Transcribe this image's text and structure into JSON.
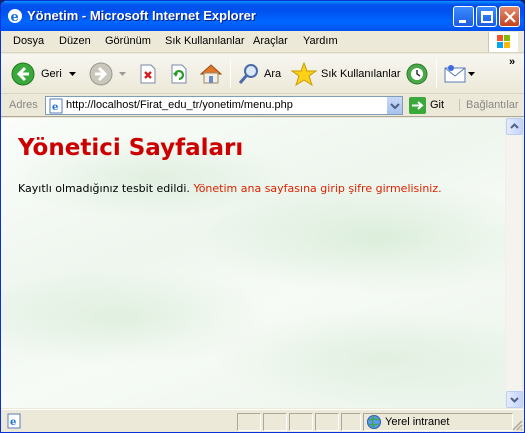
{
  "window": {
    "title": "Yönetim - Microsoft Internet Explorer"
  },
  "menubar": {
    "items": [
      {
        "label": "Dosya"
      },
      {
        "label": "Düzen"
      },
      {
        "label": "Görünüm"
      },
      {
        "label": "Sık Kullanılanlar"
      },
      {
        "label": "Araçlar"
      },
      {
        "label": "Yardım"
      }
    ]
  },
  "toolbar": {
    "back_label": "Geri",
    "search_label": "Ara",
    "favorites_label": "Sık Kullanılanlar",
    "overflow": "»"
  },
  "addressbar": {
    "label": "Adres",
    "url": "http://localhost/Firat_edu_tr/yonetim/menu.php",
    "go_label": "Git",
    "links_label": "Bağlantılar"
  },
  "page": {
    "heading": "Yönetici Sayfaları",
    "message": "Kayıtlı olmadığınız tesbit edildi.",
    "link_text": "Yönetim ana sayfasına girip şifre girmelisiniz."
  },
  "statusbar": {
    "zone": "Yerel intranet"
  },
  "colors": {
    "heading": "#cc0000",
    "link": "#dd2200",
    "titlebar": "#0053ee"
  }
}
